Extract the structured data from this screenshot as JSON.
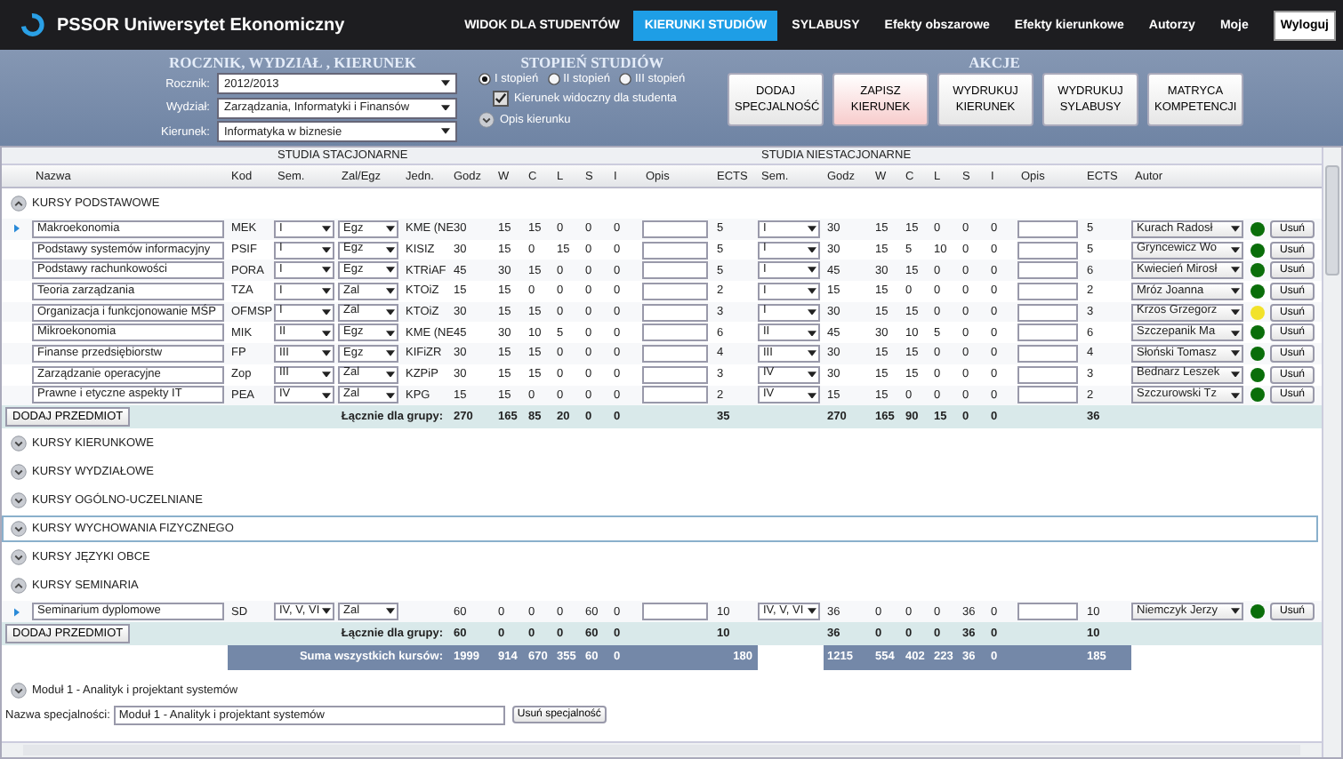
{
  "app": {
    "title": "PSSOR Uniwersytet Ekonomiczny"
  },
  "nav": [
    {
      "label": "WIDOK DLA STUDENTÓW",
      "selected": false
    },
    {
      "label": "KIERUNKI STUDIÓW",
      "selected": true
    },
    {
      "label": "SYLABUSY",
      "selected": false
    },
    {
      "label": "Efekty obszarowe",
      "selected": false
    },
    {
      "label": "Efekty kierunkowe",
      "selected": false
    },
    {
      "label": "Autorzy",
      "selected": false
    },
    {
      "label": "Moje",
      "selected": false
    }
  ],
  "logout": "Wyloguj",
  "filters": {
    "heading": "ROCZNIK, WYDZIAŁ , KIERUNEK",
    "fields": [
      {
        "label": "Rocznik:",
        "value": "2012/2013"
      },
      {
        "label": "Wydział:",
        "value": "Zarządzania, Informatyki i Finansów"
      },
      {
        "label": "Kierunek:",
        "value": "Informatyka w biznesie"
      }
    ]
  },
  "degree": {
    "heading": "STOPIEŃ STUDIÓW",
    "options": [
      {
        "label": "I stopień",
        "selected": true
      },
      {
        "label": "II stopień",
        "selected": false
      },
      {
        "label": "III stopień",
        "selected": false
      }
    ],
    "visible": {
      "label": "Kierunek widoczny dla studenta",
      "checked": true
    },
    "description": {
      "label": "Opis kierunku",
      "expanded": false
    }
  },
  "actions": {
    "heading": "AKCJE",
    "buttons": [
      {
        "label": "DODAJ SPECJALNOŚĆ",
        "highlighted": false
      },
      {
        "label": "ZAPISZ KIERUNEK",
        "highlighted": true
      },
      {
        "label": "WYDRUKUJ KIERUNEK",
        "highlighted": false
      },
      {
        "label": "WYDRUKUJ SYLABUSY",
        "highlighted": false
      },
      {
        "label": "MATRYCA KOMPETENCJI",
        "highlighted": false
      }
    ]
  },
  "table": {
    "sections": [
      "STUDIA STACJONARNE",
      "STUDIA NIESTACJONARNE"
    ],
    "columns": [
      "Nazwa",
      "Kod",
      "Sem.",
      "Zal/Egz",
      "Jedn.",
      "Godz",
      "W",
      "C",
      "L",
      "S",
      "I",
      "Opis",
      "ECTS",
      "Sem.",
      "Godz",
      "W",
      "C",
      "L",
      "S",
      "I",
      "Opis",
      "ECTS",
      "Autor"
    ],
    "groups": [
      {
        "title": "KURSY PODSTAWOWE",
        "expanded": true,
        "selected": false,
        "rows": [
          {
            "current": true,
            "name": "Makroekonomia",
            "code": "MEK",
            "semester": "I",
            "assessment": "Egz",
            "unit": "KME (NE",
            "stationary": [
              "30",
              "15",
              "15",
              "0",
              "0",
              "0"
            ],
            "ects": "5",
            "extramural_semester": "I",
            "extramural": [
              "30",
              "15",
              "15",
              "0",
              "0",
              "0"
            ],
            "extramural_ects": "5",
            "author": "Kurach Radosł",
            "color": "#0a6e0a",
            "delete": "Usuń"
          },
          {
            "current": false,
            "name": "Podstawy systemów informacyjny",
            "code": "PSIF",
            "semester": "I",
            "assessment": "Egz",
            "unit": "KISIZ",
            "stationary": [
              "30",
              "15",
              "0",
              "15",
              "0",
              "0"
            ],
            "ects": "5",
            "extramural_semester": "I",
            "extramural": [
              "30",
              "15",
              "5",
              "10",
              "0",
              "0"
            ],
            "extramural_ects": "5",
            "author": "Gryncewicz Wo",
            "color": "#0a6e0a",
            "delete": "Usuń"
          },
          {
            "current": false,
            "name": "Podstawy rachunkowości",
            "code": "PORA",
            "semester": "I",
            "assessment": "Egz",
            "unit": "KTRiAF",
            "stationary": [
              "45",
              "30",
              "15",
              "0",
              "0",
              "0"
            ],
            "ects": "5",
            "extramural_semester": "I",
            "extramural": [
              "45",
              "30",
              "15",
              "0",
              "0",
              "0"
            ],
            "extramural_ects": "6",
            "author": "Kwiecień Mirosł",
            "color": "#0a6e0a",
            "delete": "Usuń"
          },
          {
            "current": false,
            "name": "Teoria zarządzania",
            "code": "TZA",
            "semester": "I",
            "assessment": "Zal",
            "unit": "KTOiZ",
            "stationary": [
              "15",
              "15",
              "0",
              "0",
              "0",
              "0"
            ],
            "ects": "2",
            "extramural_semester": "I",
            "extramural": [
              "15",
              "15",
              "0",
              "0",
              "0",
              "0"
            ],
            "extramural_ects": "2",
            "author": "Mróz Joanna",
            "color": "#0a6e0a",
            "delete": "Usuń"
          },
          {
            "current": false,
            "name": "Organizacja i funkcjonowanie MŚP",
            "code": "OFMSP",
            "semester": "I",
            "assessment": "Zal",
            "unit": "KTOiZ",
            "stationary": [
              "30",
              "15",
              "15",
              "0",
              "0",
              "0"
            ],
            "ects": "3",
            "extramural_semester": "I",
            "extramural": [
              "30",
              "15",
              "15",
              "0",
              "0",
              "0"
            ],
            "extramural_ects": "3",
            "author": "Krzos Grzegorz",
            "color": "#f2e22a",
            "delete": "Usuń"
          },
          {
            "current": false,
            "name": "Mikroekonomia",
            "code": "MIK",
            "semester": "II",
            "assessment": "Egz",
            "unit": "KME (NE",
            "stationary": [
              "45",
              "30",
              "10",
              "5",
              "0",
              "0"
            ],
            "ects": "6",
            "extramural_semester": "II",
            "extramural": [
              "45",
              "30",
              "10",
              "5",
              "0",
              "0"
            ],
            "extramural_ects": "6",
            "author": "Szczepanik Ma",
            "color": "#0a6e0a",
            "delete": "Usuń"
          },
          {
            "current": false,
            "name": "Finanse przedsiębiorstw",
            "code": "FP",
            "semester": "III",
            "assessment": "Egz",
            "unit": "KIFiZR",
            "stationary": [
              "30",
              "15",
              "15",
              "0",
              "0",
              "0"
            ],
            "ects": "4",
            "extramural_semester": "III",
            "extramural": [
              "30",
              "15",
              "15",
              "0",
              "0",
              "0"
            ],
            "extramural_ects": "4",
            "author": "Słoński Tomasz",
            "color": "#0a6e0a",
            "delete": "Usuń"
          },
          {
            "current": false,
            "name": "Zarządzanie operacyjne",
            "code": "Zop",
            "semester": "III",
            "assessment": "Zal",
            "unit": "KZPiP",
            "stationary": [
              "30",
              "15",
              "15",
              "0",
              "0",
              "0"
            ],
            "ects": "3",
            "extramural_semester": "IV",
            "extramural": [
              "30",
              "15",
              "15",
              "0",
              "0",
              "0"
            ],
            "extramural_ects": "3",
            "author": "Bednarz Leszek",
            "color": "#0a6e0a",
            "delete": "Usuń"
          },
          {
            "current": false,
            "name": "Prawne i etyczne aspekty IT",
            "code": "PEA",
            "semester": "IV",
            "assessment": "Zal",
            "unit": "KPG",
            "stationary": [
              "15",
              "15",
              "0",
              "0",
              "0",
              "0"
            ],
            "ects": "2",
            "extramural_semester": "IV",
            "extramural": [
              "15",
              "15",
              "0",
              "0",
              "0",
              "0"
            ],
            "extramural_ects": "2",
            "author": "Szczurowski Tz",
            "color": "#0a6e0a",
            "delete": "Usuń"
          }
        ],
        "add_button": "DODAJ PRZEDMIOT",
        "total_label": "Łącznie dla grupy:",
        "totals": {
          "stationary": [
            "270",
            "165",
            "85",
            "20",
            "0",
            "0"
          ],
          "stationary_ects": "35",
          "extramural": [
            "270",
            "165",
            "90",
            "15",
            "0",
            "0"
          ],
          "extramural_ects": "36"
        }
      },
      {
        "title": "KURSY KIERUNKOWE",
        "expanded": false,
        "selected": false
      },
      {
        "title": "KURSY WYDZIAŁOWE",
        "expanded": false,
        "selected": false
      },
      {
        "title": "KURSY OGÓLNO-UCZELNIANE",
        "expanded": false,
        "selected": false
      },
      {
        "title": "KURSY WYCHOWANIA FIZYCZNEGO",
        "expanded": false,
        "selected": true
      },
      {
        "title": "KURSY JĘZYKI OBCE",
        "expanded": false,
        "selected": false
      },
      {
        "title": "KURSY SEMINARIA",
        "expanded": true,
        "selected": false,
        "rows": [
          {
            "current": true,
            "name": "Seminarium dyplomowe",
            "code": "SD",
            "semester": "IV, V, VI",
            "assessment": "Zal",
            "unit": "",
            "stationary": [
              "60",
              "0",
              "0",
              "0",
              "60",
              "0"
            ],
            "ects": "10",
            "extramural_semester": "IV, V, VI",
            "extramural": [
              "36",
              "0",
              "0",
              "0",
              "36",
              "0"
            ],
            "extramural_ects": "10",
            "author": "Niemczyk Jerzy",
            "color": "#0a6e0a",
            "delete": "Usuń"
          }
        ],
        "add_button": "DODAJ PRZEDMIOT",
        "total_label": "Łącznie dla grupy:",
        "totals": {
          "stationary": [
            "60",
            "0",
            "0",
            "0",
            "60",
            "0"
          ],
          "stationary_ects": "10",
          "extramural": [
            "36",
            "0",
            "0",
            "0",
            "36",
            "0"
          ],
          "extramural_ects": "10"
        }
      }
    ],
    "grand_total": {
      "label": "Suma wszystkich kursów:",
      "stationary": [
        "1999",
        "914",
        "670",
        "355",
        "60",
        "0"
      ],
      "stationary_ects": "180",
      "extramural": [
        "1215",
        "554",
        "402",
        "223",
        "36",
        "0"
      ],
      "extramural_ects": "185"
    },
    "specialization": {
      "module": "Moduł 1 - Analityk i projektant systemów",
      "expanded": false,
      "name_label": "Nazwa specjalności:",
      "name_value": "Moduł 1 - Analityk i projektant systemów",
      "delete_button": "Usuń specjalność"
    }
  }
}
